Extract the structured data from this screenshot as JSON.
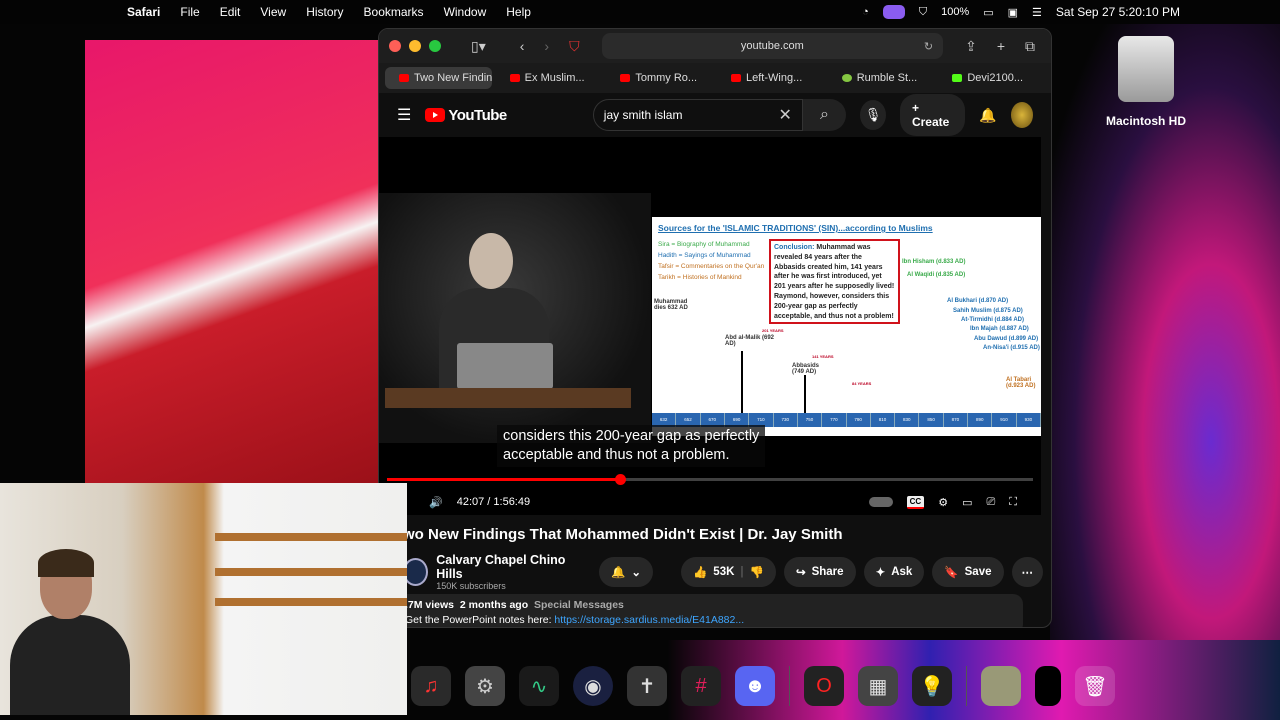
{
  "menubar": {
    "app": "Safari",
    "items": [
      "File",
      "Edit",
      "View",
      "History",
      "Bookmarks",
      "Window",
      "Help"
    ],
    "battery": "100%",
    "datetime": "Sat Sep 27  5:20:10 PM"
  },
  "desktop": {
    "drive_label": "Macintosh HD"
  },
  "browser": {
    "url": "youtube.com",
    "tabs": [
      {
        "title": "Two New Findings T...",
        "favicon": "youtube",
        "active": true
      },
      {
        "title": "Ex Muslim...",
        "favicon": "youtube"
      },
      {
        "title": "Tommy Ro...",
        "favicon": "youtube"
      },
      {
        "title": "Left-Wing...",
        "favicon": "youtube"
      },
      {
        "title": "Rumble St...",
        "favicon": "rumble"
      },
      {
        "title": "Devi2100...",
        "favicon": "kick"
      }
    ]
  },
  "youtube": {
    "logo": "YouTube",
    "search_value": "jay smith islam",
    "create_label": "Create",
    "player": {
      "slide": {
        "title": "Sources for the 'ISLAMIC TRADITIONS' (SIN)...according to Muslims",
        "legend": [
          "Sira = Biography of Muhammad",
          "Hadith = Sayings of Muhammad",
          "Tafsir = Commentaries on the Qur'an",
          "Tarikh = Histories of Mankind"
        ],
        "conclusion_label": "Conclusion:",
        "conclusion": "Muhammad was revealed 84 years after the Abbasids created him, 141 years after he was first introduced, yet 201 years after he supposedly lived! Raymond, however, considers this 200-year gap as perfectly acceptable, and thus not a problem!",
        "events": [
          "Muhammad dies 632 AD",
          "Abd al-Malik (692 AD)",
          "Abbasids (749 AD)",
          "Ibn Hisham (d.833 AD)",
          "Al Waqidi (d.835 AD)",
          "Al Bukhari (d.870 AD)",
          "Sahih Muslim (d.875 AD)",
          "At-Tirmidhi (d.884 AD)",
          "Ibn Majah (d.887 AD)",
          "Abu Dawud (d.899 AD)",
          "An-Nisa'i (d.915 AD)",
          "Al Tabari (d.923 AD)"
        ],
        "spans": [
          "201 YEARS",
          "141 YEARS",
          "84 YEARS"
        ],
        "timeline": [
          "632",
          "652",
          "670",
          "690",
          "710",
          "730",
          "750",
          "770",
          "790",
          "810",
          "830",
          "850",
          "870",
          "890",
          "910",
          "930"
        ]
      },
      "caption_line1": "considers this 200-year gap as perfectly",
      "caption_line2": "acceptable and thus not a problem.",
      "time": "42:07 / 1:56:49",
      "progress": 0.36
    },
    "video_title": "wo New Findings That Mohammed Didn't Exist | Dr. Jay Smith",
    "channel": {
      "name": "Calvary Chapel Chino Hills",
      "subscribers": "150K subscribers"
    },
    "likes": "53K",
    "share_label": "Share",
    "ask_label": "Ask",
    "save_label": "Save",
    "description": {
      "views": ".7M views",
      "age": "2 months ago",
      "tag": "Special Messages",
      "text": "Get the PowerPoint notes here: ",
      "link": "https://storage.sardius.media/E41A882..."
    }
  },
  "dock": [
    "Music",
    "System Settings",
    "Activity Monitor",
    "OBS",
    "App",
    "Slack",
    "Discord",
    "Opera",
    "Calculator",
    "Lightbulb",
    "Game",
    "Safari window",
    "Trash"
  ]
}
